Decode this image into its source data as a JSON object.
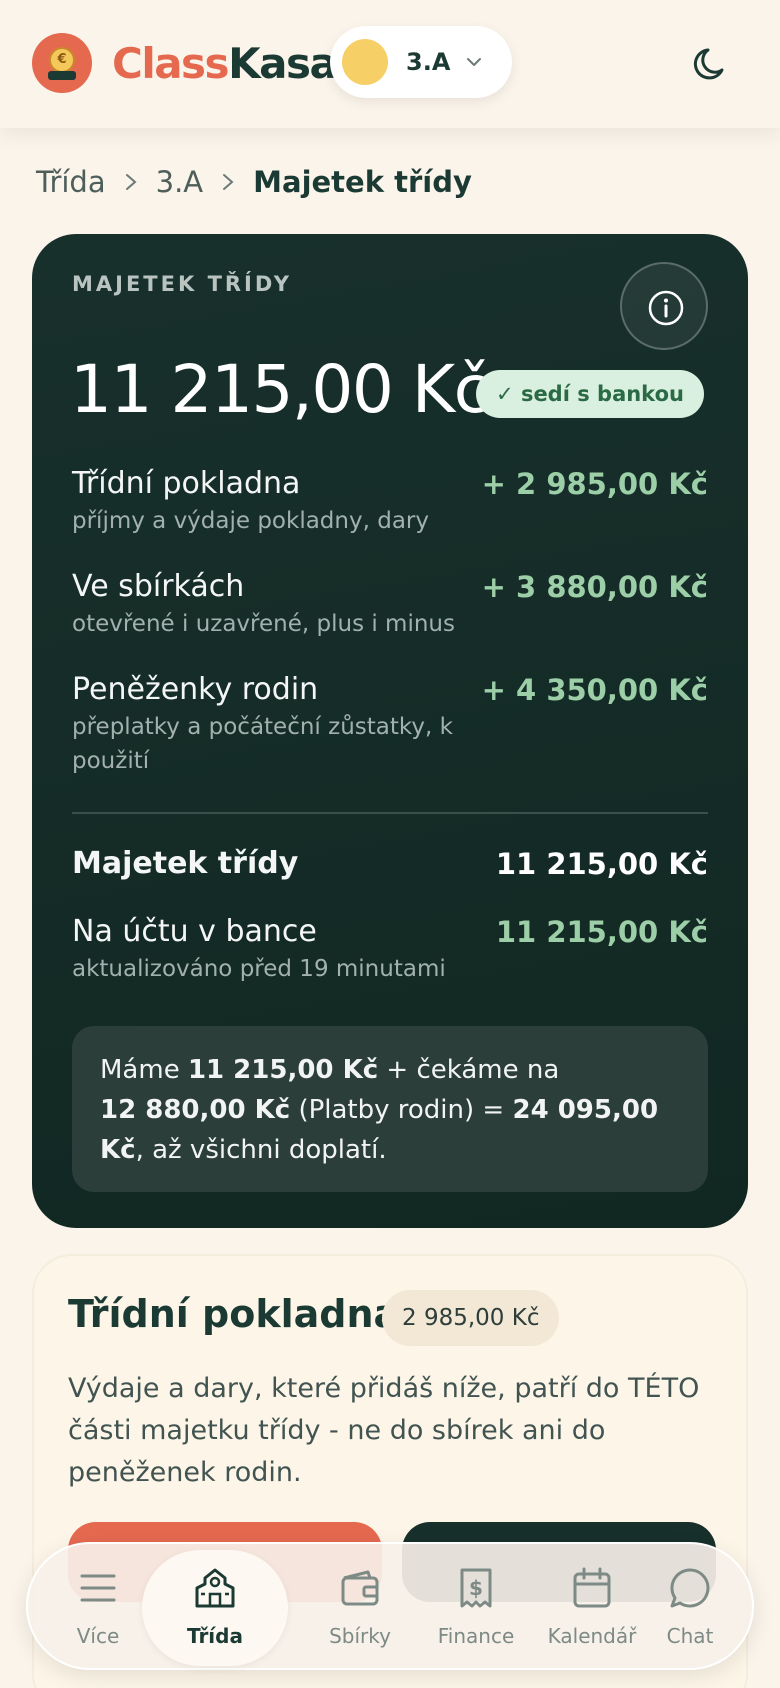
{
  "header": {
    "brand_part1": "Class",
    "brand_part2": "Kasa",
    "class_selector": "3.A",
    "logo_coin_glyph": "€"
  },
  "breadcrumb": {
    "items": [
      "Třída",
      "3.A"
    ],
    "current": "Majetek třídy"
  },
  "asset_card": {
    "caption": "MAJETEK TŘÍDY",
    "total": "11 215,00 Kč",
    "bank_badge": "✓ sedí s bankou",
    "rows": [
      {
        "name": "Třídní pokladna",
        "desc": "příjmy a výdaje pokladny, dary",
        "amount": "+ 2 985,00 Kč"
      },
      {
        "name": "Ve sbírkách",
        "desc": "otevřené i uzavřené, plus i minus",
        "amount": "+ 3 880,00 Kč"
      },
      {
        "name": "Peněženky rodin",
        "desc": "přeplatky a počáteční zůstatky, k použití",
        "amount": "+ 4 350,00 Kč"
      }
    ],
    "total_row": {
      "name": "Majetek třídy",
      "amount": "11 215,00 Kč"
    },
    "bank_row": {
      "name": "Na účtu v bance",
      "desc": "aktualizováno před 19 minutami",
      "amount": "11 215,00 Kč"
    },
    "note": {
      "p1": "Máme ",
      "v1": "11 215,00 Kč",
      "p2": " + čekáme na ",
      "v2": "12 880,00 Kč",
      "p3": " (Platby rodin) = ",
      "v3": "24 095,00 Kč",
      "p4": ", až všichni doplatí."
    }
  },
  "register_card": {
    "title": "Třídní pokladna",
    "sum": "2 985,00 Kč",
    "text": "Výdaje a dary, které přidáš níže, patří do TÉTO části majetku třídy - ne do sbírek ani do peněženek rodin."
  },
  "bottom_nav": {
    "items": [
      {
        "label": "Více",
        "icon": "menu-icon"
      },
      {
        "label": "Třída",
        "icon": "school-icon",
        "active": true
      },
      {
        "label": "Sbírky",
        "icon": "wallet-icon"
      },
      {
        "label": "Finance",
        "icon": "receipt-icon"
      },
      {
        "label": "Kalendář",
        "icon": "calendar-icon"
      },
      {
        "label": "Chat",
        "icon": "chat-icon"
      }
    ]
  },
  "colors": {
    "brand_red": "#e5694f",
    "dark_green": "#1c3a34",
    "card_dark": "#18302c",
    "positive_green": "#9ccfa7",
    "background": "#fbf4ea"
  }
}
